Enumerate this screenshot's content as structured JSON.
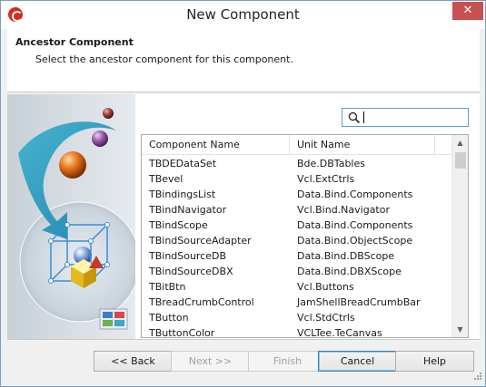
{
  "window": {
    "title": "New Component"
  },
  "header": {
    "title": "Ancestor Component",
    "subtitle": "Select the ancestor component for this component."
  },
  "search": {
    "value": "",
    "placeholder": ""
  },
  "grid": {
    "columns": [
      "Component Name",
      "Unit Name"
    ],
    "rows": [
      [
        "TBDEDataSet",
        "Bde.DBTables"
      ],
      [
        "TBevel",
        "Vcl.ExtCtrls"
      ],
      [
        "TBindingsList",
        "Data.Bind.Components"
      ],
      [
        "TBindNavigator",
        "Vcl.Bind.Navigator"
      ],
      [
        "TBindScope",
        "Data.Bind.Components"
      ],
      [
        "TBindSourceAdapter",
        "Data.Bind.ObjectScope"
      ],
      [
        "TBindSourceDB",
        "Data.Bind.DBScope"
      ],
      [
        "TBindSourceDBX",
        "Data.Bind.DBXScope"
      ],
      [
        "TBitBtn",
        "Vcl.Buttons"
      ],
      [
        "TBreadCrumbControl",
        "JamShellBreadCrumbBar"
      ],
      [
        "TButton",
        "Vcl.StdCtrls"
      ],
      [
        "TButtonColor",
        "VCLTee.TeCanvas"
      ]
    ]
  },
  "buttons": {
    "back": "<< Back",
    "next": "Next >>",
    "finish": "Finish",
    "cancel": "Cancel",
    "help": "Help"
  },
  "icons": {
    "app": "app-icon",
    "close": "close-icon",
    "search": "search-icon",
    "scroll_up": "chevron-up-icon",
    "scroll_down": "chevron-down-icon",
    "grip": "resize-grip-icon"
  },
  "colors": {
    "accent": "#5b9bd5",
    "close": "#c75050",
    "brand": "#d62a1e"
  }
}
